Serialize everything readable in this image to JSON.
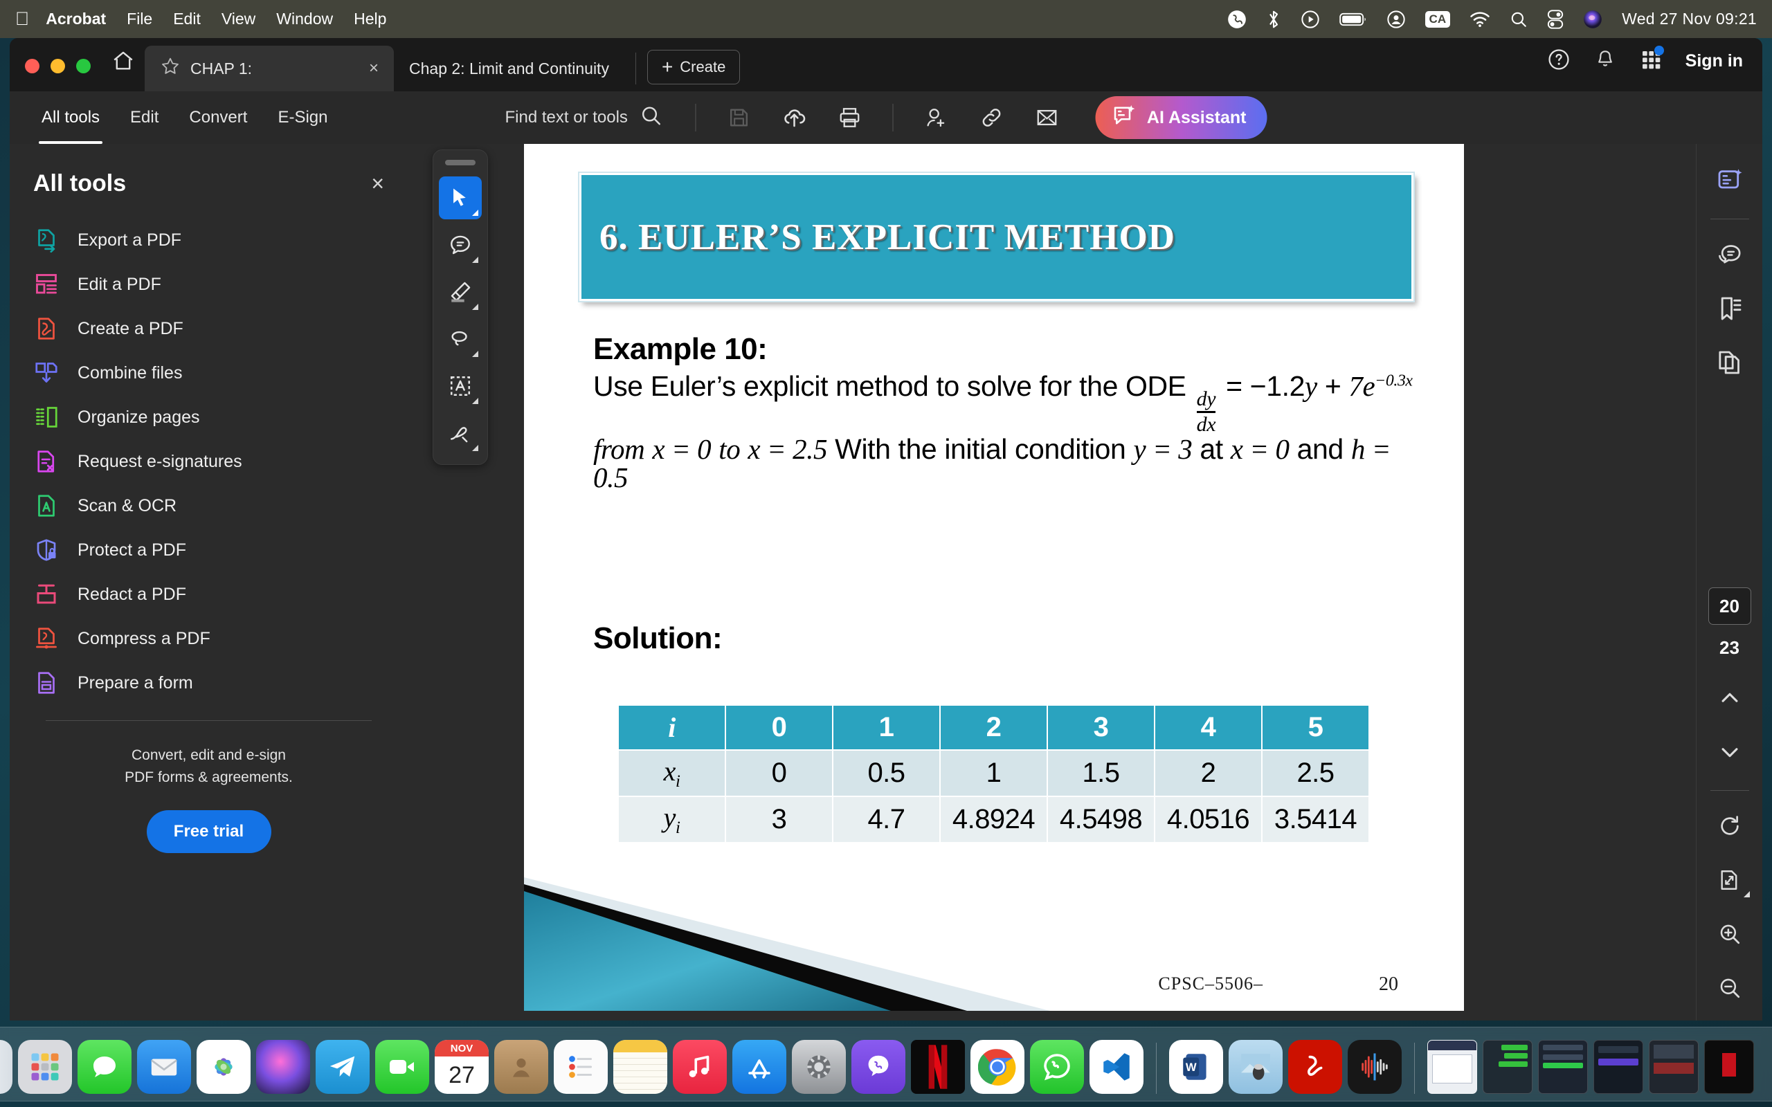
{
  "menubar": {
    "apple_icon": "apple-icon",
    "app_title": "Acrobat",
    "items": [
      "File",
      "Edit",
      "View",
      "Window",
      "Help"
    ],
    "status_icons": [
      "viber-icon",
      "bluetooth-icon",
      "play-circle-icon",
      "battery-icon",
      "user-circle-icon",
      "ca-input-icon",
      "wifi-icon",
      "search-icon",
      "control-center-icon",
      "siri-icon"
    ],
    "ca_label": "CA",
    "clock": "Wed 27 Nov  09:21"
  },
  "window": {
    "tabs": [
      {
        "label": "CHAP 1:",
        "active": true,
        "close": "×"
      },
      {
        "label": "Chap 2:  Limit and Continuity",
        "active": false
      }
    ],
    "create_button": "Create",
    "create_plus": "+",
    "sign_in": "Sign in",
    "help_icon": "help-circle-icon",
    "bell_icon": "bell-icon",
    "apps_icon": "app-grid-icon"
  },
  "toolbar": {
    "tabs": [
      {
        "label": "All tools",
        "selected": true
      },
      {
        "label": "Edit",
        "selected": false
      },
      {
        "label": "Convert",
        "selected": false
      },
      {
        "label": "E-Sign",
        "selected": false
      }
    ],
    "find_placeholder": "Find text or tools",
    "icons": [
      "save-icon",
      "upload-cloud-icon",
      "print-icon",
      "add-person-icon",
      "link-icon",
      "envelope-icon"
    ],
    "ai_assistant": "AI Assistant",
    "ai_gradient_from": "#ec5f53",
    "ai_gradient_to": "#5b6ef0"
  },
  "left_panel": {
    "title": "All tools",
    "close": "×",
    "items": [
      {
        "label": "Export a PDF",
        "icon": "export-pdf-icon",
        "color": "#0fa3a3"
      },
      {
        "label": "Edit a PDF",
        "icon": "edit-pdf-icon",
        "color": "#ea4a9a"
      },
      {
        "label": "Create a PDF",
        "icon": "create-pdf-icon",
        "color": "#f0533f"
      },
      {
        "label": "Combine files",
        "icon": "combine-files-icon",
        "color": "#6d72f5"
      },
      {
        "label": "Organize pages",
        "icon": "organize-pages-icon",
        "color": "#67d63a"
      },
      {
        "label": "Request e-signatures",
        "icon": "request-esign-icon",
        "color": "#d946ef"
      },
      {
        "label": "Scan & OCR",
        "icon": "scan-ocr-icon",
        "color": "#2ecc71"
      },
      {
        "label": "Protect a PDF",
        "icon": "protect-pdf-icon",
        "color": "#7b83f7"
      },
      {
        "label": "Redact a PDF",
        "icon": "redact-pdf-icon",
        "color": "#ea4a7a"
      },
      {
        "label": "Compress a PDF",
        "icon": "compress-pdf-icon",
        "color": "#f0533f"
      },
      {
        "label": "Prepare a form",
        "icon": "prepare-form-icon",
        "color": "#a86ff5"
      }
    ],
    "promo_line1": "Convert, edit and e-sign",
    "promo_line2": "PDF forms & agreements.",
    "trial_button": "Free trial",
    "trial_color": "#1473e6"
  },
  "float_tools": [
    {
      "icon": "select-cursor-icon",
      "active": true
    },
    {
      "icon": "comment-icon",
      "active": false
    },
    {
      "icon": "highlight-icon",
      "active": false
    },
    {
      "icon": "draw-lasso-icon",
      "active": false
    },
    {
      "icon": "add-text-icon",
      "active": false
    },
    {
      "icon": "sign-pen-icon",
      "active": false
    }
  ],
  "document": {
    "slide_title": "6. EULER’S EXPLICIT METHOD",
    "title_bg": "#2aa3bf",
    "example_heading": "Example 10:",
    "paragraph": {
      "part1": "Use Euler’s explicit method to solve for the ODE",
      "frac_num": "dy",
      "frac_den": "dx",
      "part2": "= −1.2",
      "var_y": "y",
      "plus": "+",
      "term_7e": "7e",
      "exponent": "−0.3x",
      "from": "from",
      "range1": "x = 0",
      "to": "to",
      "range2": "x = 2.5",
      "part3": "With the initial condition",
      "init_y": "y = 3",
      "at": "at",
      "init_x": "x = 0",
      "and": "and",
      "step_h": "h = 0.5"
    },
    "solution_heading": "Solution:",
    "footer_code": "CPSC–5506–",
    "footer_page": "20"
  },
  "chart_data": {
    "type": "table",
    "title": "Euler's explicit method results",
    "row_labels": [
      "i",
      "xᵢ",
      "yᵢ"
    ],
    "header": [
      "i",
      "0",
      "1",
      "2",
      "3",
      "4",
      "5"
    ],
    "rows": [
      {
        "label": "x",
        "sub": "i",
        "values": [
          "0",
          "0.5",
          "1",
          "1.5",
          "2",
          "2.5"
        ]
      },
      {
        "label": "y",
        "sub": "i",
        "values": [
          "3",
          "4.7",
          "4.8924",
          "4.5498",
          "4.0516",
          "3.5414"
        ]
      }
    ],
    "header_bg": "#2aa3bf",
    "row1_bg": "#d5e4e9",
    "row2_bg": "#e8eff1"
  },
  "right_rail": {
    "top_icons": [
      "ai-summary-icon",
      "comments-panel-icon",
      "bookmarks-icon",
      "page-thumbnails-icon"
    ],
    "current_page": "20",
    "total_pages": "23",
    "nav_icons": [
      "chevron-up-icon",
      "chevron-down-icon",
      "rotate-icon",
      "fit-page-icon",
      "zoom-in-icon",
      "zoom-out-icon"
    ]
  },
  "dock": {
    "apps": [
      {
        "name": "finder-icon",
        "running": true
      },
      {
        "name": "launchpad-icon",
        "running": false
      },
      {
        "name": "messages-icon",
        "running": true
      },
      {
        "name": "mail-icon",
        "running": false
      },
      {
        "name": "photos-icon",
        "running": false
      },
      {
        "name": "siri-icon",
        "running": false
      },
      {
        "name": "telegram-icon",
        "running": false
      },
      {
        "name": "facetime-icon",
        "running": false
      },
      {
        "name": "calendar-icon",
        "running": false,
        "month": "NOV",
        "day": "27"
      },
      {
        "name": "contacts-icon",
        "running": false
      },
      {
        "name": "reminders-icon",
        "running": false
      },
      {
        "name": "notes-icon",
        "running": false
      },
      {
        "name": "music-icon",
        "running": false
      },
      {
        "name": "appstore-icon",
        "running": false
      },
      {
        "name": "system-settings-icon",
        "running": false
      },
      {
        "name": "viber-icon",
        "running": true
      },
      {
        "name": "netflix-icon",
        "running": true
      },
      {
        "name": "chrome-icon",
        "running": true
      },
      {
        "name": "whatsapp-icon",
        "running": true
      },
      {
        "name": "vscode-icon",
        "running": true
      },
      {
        "name": "word-icon",
        "running": true
      },
      {
        "name": "preview-icon",
        "running": true
      },
      {
        "name": "acrobat-icon",
        "running": true
      },
      {
        "name": "audio-icon",
        "running": true
      }
    ],
    "minimized_count": 7,
    "trash": "trash-icon"
  }
}
